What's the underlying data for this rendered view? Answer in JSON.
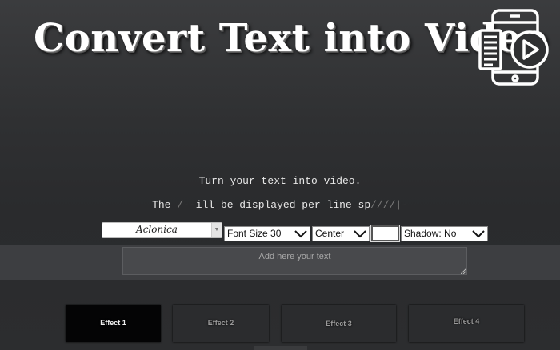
{
  "header": {
    "title": "Convert Text into Video",
    "logo_icon": "phone-with-text-and-play-icon"
  },
  "intro": {
    "line1": "Turn your text into video.",
    "line2_prefix": "The ",
    "line2_glitch1": "/--",
    "line2_middle": "ill be displayed per line sp",
    "line2_glitch2": "////|-"
  },
  "controls": {
    "font_picker": {
      "value": "Aclonica"
    },
    "font_size": {
      "value": "Font Size 30"
    },
    "alignment": {
      "value": "Center"
    },
    "text_color": {
      "value": "#ffffff"
    },
    "shadow": {
      "value": "Shadow: No"
    }
  },
  "text_input": {
    "placeholder": "Add here your text",
    "value": ""
  },
  "effects": [
    {
      "label": "Effect 1",
      "selected": true
    },
    {
      "label": "Effect 2",
      "selected": false
    },
    {
      "label": "Effect 3",
      "selected": false
    },
    {
      "label": "Effect 4",
      "selected": false
    }
  ],
  "colors": {
    "background": "#2f3032",
    "selected_effect": "#040405",
    "effect_tile": "#2b2c2e"
  }
}
